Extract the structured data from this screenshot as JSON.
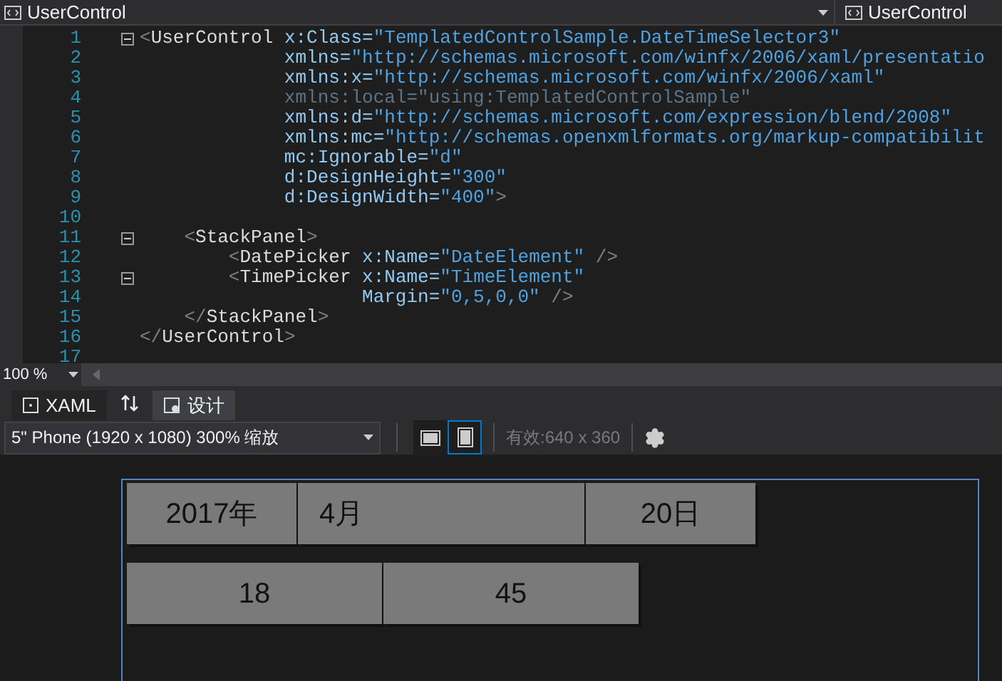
{
  "top_bar": {
    "type_dropdown": "UserControl",
    "member_dropdown": "UserControl"
  },
  "editor": {
    "lines": [
      {
        "number": "1",
        "fold": true,
        "tokens": [
          {
            "kind": "bracket",
            "text": "<"
          },
          {
            "kind": "element",
            "text": "UserControl"
          },
          {
            "kind": "attr",
            "text": " x:Class="
          },
          {
            "kind": "value",
            "text": "\"TemplatedControlSample.DateTimeSelector3\""
          }
        ]
      },
      {
        "number": "2",
        "fold": false,
        "tokens": [
          {
            "kind": "attr",
            "text": "             xmlns="
          },
          {
            "kind": "value",
            "text": "\"http://schemas.microsoft.com/winfx/2006/xaml/presentatio"
          }
        ]
      },
      {
        "number": "3",
        "fold": false,
        "tokens": [
          {
            "kind": "attr",
            "text": "             xmlns:x="
          },
          {
            "kind": "value",
            "text": "\"http://schemas.microsoft.com/winfx/2006/xaml\""
          }
        ]
      },
      {
        "number": "4",
        "fold": false,
        "tokens": [
          {
            "kind": "dim",
            "text": "             xmlns:local=\"using:TemplatedControlSample\""
          }
        ]
      },
      {
        "number": "5",
        "fold": false,
        "tokens": [
          {
            "kind": "attr",
            "text": "             xmlns:d="
          },
          {
            "kind": "value",
            "text": "\"http://schemas.microsoft.com/expression/blend/2008\""
          }
        ]
      },
      {
        "number": "6",
        "fold": false,
        "tokens": [
          {
            "kind": "attr",
            "text": "             xmlns:mc="
          },
          {
            "kind": "value",
            "text": "\"http://schemas.openxmlformats.org/markup-compatibilit"
          }
        ]
      },
      {
        "number": "7",
        "fold": false,
        "tokens": [
          {
            "kind": "attr",
            "text": "             mc:Ignorable="
          },
          {
            "kind": "value",
            "text": "\"d\""
          }
        ]
      },
      {
        "number": "8",
        "fold": false,
        "tokens": [
          {
            "kind": "attr",
            "text": "             d:DesignHeight="
          },
          {
            "kind": "value",
            "text": "\"300\""
          }
        ]
      },
      {
        "number": "9",
        "fold": false,
        "tokens": [
          {
            "kind": "attr",
            "text": "             d:DesignWidth="
          },
          {
            "kind": "value",
            "text": "\"400\""
          },
          {
            "kind": "bracket",
            "text": ">"
          }
        ]
      },
      {
        "number": "10",
        "fold": false
      },
      {
        "number": "11",
        "fold": true,
        "tokens": [
          {
            "kind": "bracket",
            "text": "    <"
          },
          {
            "kind": "element",
            "text": "StackPanel"
          },
          {
            "kind": "bracket",
            "text": ">"
          }
        ]
      },
      {
        "number": "12",
        "fold": false,
        "tokens": [
          {
            "kind": "bracket",
            "text": "        <"
          },
          {
            "kind": "element",
            "text": "DatePicker"
          },
          {
            "kind": "attr",
            "text": " x:Name="
          },
          {
            "kind": "value",
            "text": "\"DateElement\""
          },
          {
            "kind": "bracket",
            "text": " />"
          }
        ]
      },
      {
        "number": "13",
        "fold": true,
        "tokens": [
          {
            "kind": "bracket",
            "text": "        <"
          },
          {
            "kind": "element",
            "text": "TimePicker"
          },
          {
            "kind": "attr",
            "text": " x:Name="
          },
          {
            "kind": "value",
            "text": "\"TimeElement\""
          }
        ]
      },
      {
        "number": "14",
        "fold": false,
        "tokens": [
          {
            "kind": "attr",
            "text": "                    Margin="
          },
          {
            "kind": "value",
            "text": "\"0,5,0,0\""
          },
          {
            "kind": "bracket",
            "text": " />"
          }
        ]
      },
      {
        "number": "15",
        "fold": false,
        "tokens": [
          {
            "kind": "bracket",
            "text": "    </"
          },
          {
            "kind": "element",
            "text": "StackPanel"
          },
          {
            "kind": "bracket",
            "text": ">"
          }
        ]
      },
      {
        "number": "16",
        "fold": false,
        "tokens": [
          {
            "kind": "bracket",
            "text": "</"
          },
          {
            "kind": "element",
            "text": "UserControl"
          },
          {
            "kind": "bracket",
            "text": ">"
          }
        ]
      },
      {
        "number": "17",
        "fold": false
      }
    ]
  },
  "zoom": "100 %",
  "view_tabs": [
    {
      "label": "XAML",
      "selected": false
    },
    {
      "label": "设计",
      "selected": true
    }
  ],
  "toolbar": {
    "device_dropdown": "5\" Phone (1920 x 1080) 300% 缩放",
    "orientation_buttons": [
      {
        "kind": "landscape",
        "selected": false
      },
      {
        "kind": "portrait",
        "selected": true
      }
    ],
    "effective_size": "有效:640 x 360"
  },
  "preview": {
    "date_picker": [
      {
        "kind": "year",
        "text": "2017年"
      },
      {
        "kind": "month",
        "text": "4月"
      },
      {
        "kind": "day",
        "text": "20日"
      }
    ],
    "time_picker": [
      "18",
      "45"
    ]
  }
}
